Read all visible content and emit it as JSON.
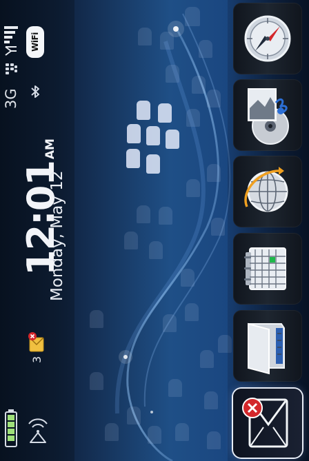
{
  "status": {
    "network": "3G",
    "wifi_label": "WiFi",
    "time": "12:01",
    "ampm": "AM",
    "date": "Monday, May 12",
    "unread_messages": "3"
  },
  "icons": {
    "signal": "signal-strength-icon",
    "blackberry": "blackberry-logo-icon",
    "wifi": "wifi-icon",
    "bluetooth": "bluetooth-icon",
    "mail_notification": "new-mail-notification-icon",
    "battery": "battery-icon",
    "antenna": "wireless-antenna-icon"
  },
  "dock": [
    {
      "id": "browser",
      "icon": "compass-icon"
    },
    {
      "id": "media",
      "icon": "media-icon"
    },
    {
      "id": "maps",
      "icon": "globe-icon"
    },
    {
      "id": "calendar",
      "icon": "calendar-icon"
    },
    {
      "id": "files",
      "icon": "folder-icon"
    },
    {
      "id": "messages",
      "icon": "messages-icon",
      "selected": true
    }
  ],
  "colors": {
    "accent_red": "#d3272b",
    "calendar_green": "#1fb84a",
    "orbit_orange": "#f0a020",
    "media_blue": "#2c6fd6"
  }
}
